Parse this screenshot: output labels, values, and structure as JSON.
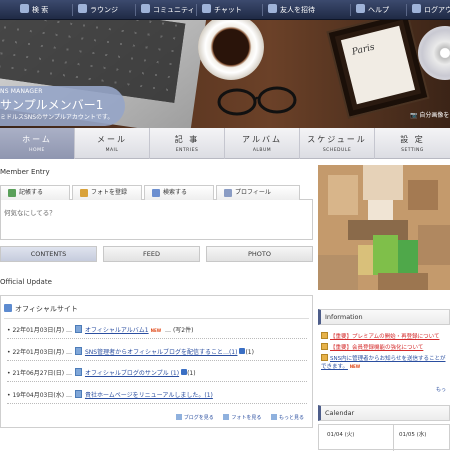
{
  "topbar": {
    "items": [
      {
        "label": "検 索",
        "icon": "search-icon"
      },
      {
        "label": "ラウンジ",
        "icon": "lounge-icon"
      },
      {
        "label": "コミュニティ",
        "icon": "community-icon"
      },
      {
        "label": "チャット",
        "icon": "chat-icon"
      },
      {
        "label": "友人を招待",
        "icon": "invite-icon"
      },
      {
        "label": "ヘルプ",
        "icon": "help-icon"
      },
      {
        "label": "ログアウ",
        "icon": "logout-icon"
      }
    ]
  },
  "hero": {
    "brand_small": "NS MANAGER",
    "brand_title": "サンプルメンバー1",
    "brand_sub": "ミドルスSNSのサンプルアカウントです。",
    "frame_text": "Paris",
    "edit_image": "自分画像を"
  },
  "nav": {
    "items": [
      {
        "jp": "ホーム",
        "en": "HOME"
      },
      {
        "jp": "メール",
        "en": "MAIL"
      },
      {
        "jp": "記 事",
        "en": "ENTRIES"
      },
      {
        "jp": "アルバム",
        "en": "ALBUM"
      },
      {
        "jp": "スケジュール",
        "en": "SCHEDULE"
      },
      {
        "jp": "設 定",
        "en": "SETTING"
      }
    ]
  },
  "member_entry": {
    "title": "Member Entry",
    "tabs": [
      {
        "label": "記帳する",
        "icon": "pencil-icon"
      },
      {
        "label": "フォトを登録",
        "icon": "photo-icon"
      },
      {
        "label": "検索する",
        "icon": "search-icon"
      },
      {
        "label": "プロフィール",
        "icon": "profile-icon"
      }
    ],
    "placeholder": "何気なにしてる？"
  },
  "content_tabs": [
    "CONTENTS",
    "FEED",
    "PHOTO"
  ],
  "official_update": {
    "title": "Official Update",
    "box_title": "オフィシャルサイト",
    "rows": [
      {
        "date": "22年01月03日(月)",
        "link": "オフィシャルアルバム1",
        "new": "NEW",
        "extra": "(写2件)"
      },
      {
        "date": "22年01月03日(月)",
        "link": "SNS管理者からオフィシャルブログを配信すること…(1)",
        "new": "",
        "extra": "(1)"
      },
      {
        "date": "21年06月27日(日)",
        "link": "オフィシャルブログのサンプル (1)",
        "new": "",
        "extra": "(1)"
      },
      {
        "date": "19年04月03日(水)",
        "link": "貴社ホームページをリニューアルしました。(1)",
        "new": "",
        "extra": ""
      }
    ],
    "footer": [
      "ブログを見る",
      "フォトを見る",
      "もっと見る"
    ]
  },
  "information": {
    "title": "Information",
    "items": [
      {
        "text": "【重要】プレミアムの開始・再登録について",
        "style": "red"
      },
      {
        "text": "【重要】会員登録機能の強化について",
        "style": "red"
      },
      {
        "text": "SNS内に管理者からお知らせを送信することができます。",
        "style": "blue",
        "new": "NEW"
      }
    ],
    "more": "もっ"
  },
  "calendar": {
    "title": "Calendar",
    "cells": [
      "01/04 (火)",
      "01/05 (水)"
    ]
  },
  "colors": {
    "topbar": "#2a3656",
    "nav_active": "#9aa1bb",
    "link": "#2a4ea0",
    "alert": "#d42a2a",
    "new_badge": "#e04a1a"
  }
}
